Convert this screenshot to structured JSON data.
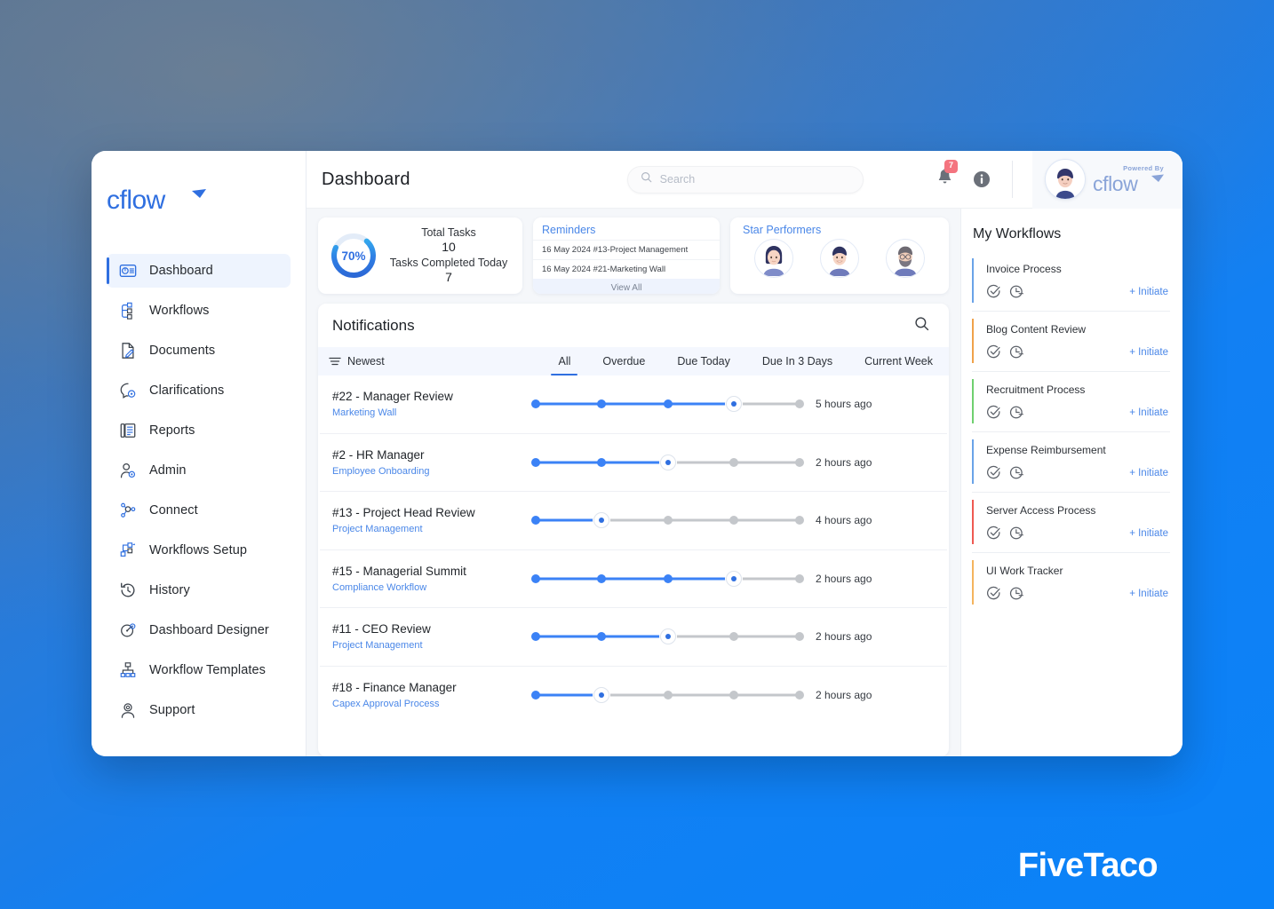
{
  "app": {
    "brand": "cflow",
    "watermark": "FiveTaco"
  },
  "sidebar": {
    "items": [
      {
        "label": "Dashboard",
        "icon": "dashboard-icon",
        "active": true
      },
      {
        "label": "Workflows",
        "icon": "workflows-icon",
        "active": false
      },
      {
        "label": "Documents",
        "icon": "documents-icon",
        "active": false
      },
      {
        "label": "Clarifications",
        "icon": "clarifications-icon",
        "active": false
      },
      {
        "label": "Reports",
        "icon": "reports-icon",
        "active": false
      },
      {
        "label": "Admin",
        "icon": "admin-icon",
        "active": false
      },
      {
        "label": "Connect",
        "icon": "connect-icon",
        "active": false
      },
      {
        "label": "Workflows Setup",
        "icon": "workflows-setup-icon",
        "active": false
      },
      {
        "label": "History",
        "icon": "history-icon",
        "active": false
      },
      {
        "label": "Dashboard Designer",
        "icon": "dashboard-designer-icon",
        "active": false
      },
      {
        "label": "Workflow Templates",
        "icon": "workflow-templates-icon",
        "active": false
      },
      {
        "label": "Support",
        "icon": "support-icon",
        "active": false
      }
    ]
  },
  "header": {
    "title": "Dashboard",
    "search_placeholder": "Search",
    "search_value": "",
    "notification_count": "7",
    "powered_by_label": "Powered By",
    "powered_by_brand": "cflow"
  },
  "stats": {
    "total_tasks_card": {
      "percent": "70%",
      "percent_value": 70,
      "total_tasks_label": "Total Tasks",
      "total_tasks_value": "10",
      "completed_label": "Tasks Completed Today",
      "completed_value": "7"
    },
    "reminders_card": {
      "title": "Reminders",
      "items": [
        "16 May 2024 #13-Project Management",
        "16 May 2024 #21-Marketing Wall"
      ],
      "view_all_label": "View All"
    },
    "star_performers_card": {
      "title": "Star Performers",
      "avatars": [
        "avatar-female-dark-hair",
        "avatar-male-short-hair",
        "avatar-male-beard-glasses"
      ]
    }
  },
  "notifications": {
    "title": "Notifications",
    "sort_label": "Newest",
    "tabs": [
      {
        "label": "All",
        "active": true
      },
      {
        "label": "Overdue",
        "active": false
      },
      {
        "label": "Due Today",
        "active": false
      },
      {
        "label": "Due In 3 Days",
        "active": false
      },
      {
        "label": "Current Week",
        "active": false
      }
    ],
    "rows": [
      {
        "name": "#22 - Manager Review",
        "workflow": "Marketing Wall",
        "steps": 5,
        "current": 4,
        "time": "5 hours ago"
      },
      {
        "name": "#2 - HR Manager",
        "workflow": "Employee Onboarding",
        "steps": 5,
        "current": 3,
        "time": "2 hours ago"
      },
      {
        "name": "#13 - Project Head Review",
        "workflow": "Project Management",
        "steps": 5,
        "current": 2,
        "time": "4 hours ago"
      },
      {
        "name": "#15 - Managerial Summit",
        "workflow": "Compliance Workflow",
        "steps": 5,
        "current": 4,
        "time": "2 hours ago"
      },
      {
        "name": "#11 - CEO Review",
        "workflow": "Project Management",
        "steps": 5,
        "current": 3,
        "time": "2 hours ago"
      },
      {
        "name": "#18 - Finance Manager",
        "workflow": "Capex Approval Process",
        "steps": 5,
        "current": 2,
        "time": "2 hours ago"
      }
    ]
  },
  "my_workflows": {
    "title": "My Workflows",
    "initiate_label": "+ Initiate",
    "items": [
      {
        "name": "Invoice Process",
        "color": "#6aa3e8"
      },
      {
        "name": "Blog Content Review",
        "color": "#f0a24a"
      },
      {
        "name": "Recruitment Process",
        "color": "#6fd06f"
      },
      {
        "name": "Expense Reimbursement",
        "color": "#6aa3e8"
      },
      {
        "name": "Server Access Process",
        "color": "#ef5a52"
      },
      {
        "name": "UI Work Tracker",
        "color": "#f4b45e"
      }
    ]
  },
  "colors": {
    "accent_blue": "#2f6fe0",
    "link_blue": "#4a87e8",
    "progress_blue": "#3b82f6",
    "progress_gray": "#c4c7cb",
    "badge_red": "#f4747f",
    "page_bg_blue": "#0a82f8"
  }
}
